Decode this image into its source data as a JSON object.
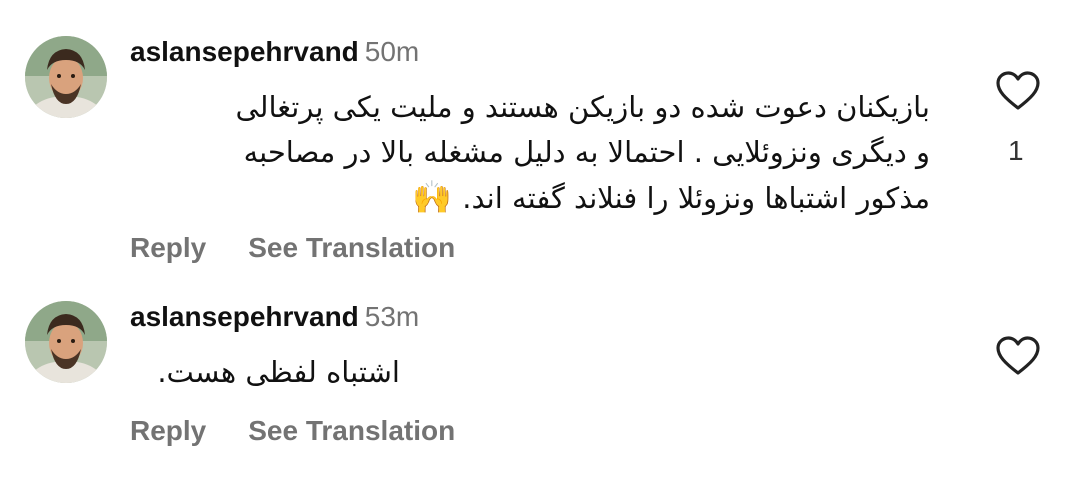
{
  "comments": [
    {
      "username": "aslansepehrvand",
      "time": "50m",
      "lines": [
        "بازیکنان دعوت شده دو بازیکن هستند و ملیت یکی پرتغالی",
        "و دیگری ونزوئلایی . احتمالا به دلیل مشغله بالا در مصاحبه",
        "مذکور اشتباها ونزوئلا را فنلاند گفته اند."
      ],
      "emoji": "🙌",
      "reply_label": "Reply",
      "translate_label": "See Translation",
      "like_count": "1",
      "icon": "heart-outline"
    },
    {
      "username": "aslansepehrvand",
      "time": "53m",
      "lines": [
        "اشتباه لفظی هست."
      ],
      "reply_label": "Reply",
      "translate_label": "See Translation",
      "icon": "heart-outline"
    }
  ]
}
